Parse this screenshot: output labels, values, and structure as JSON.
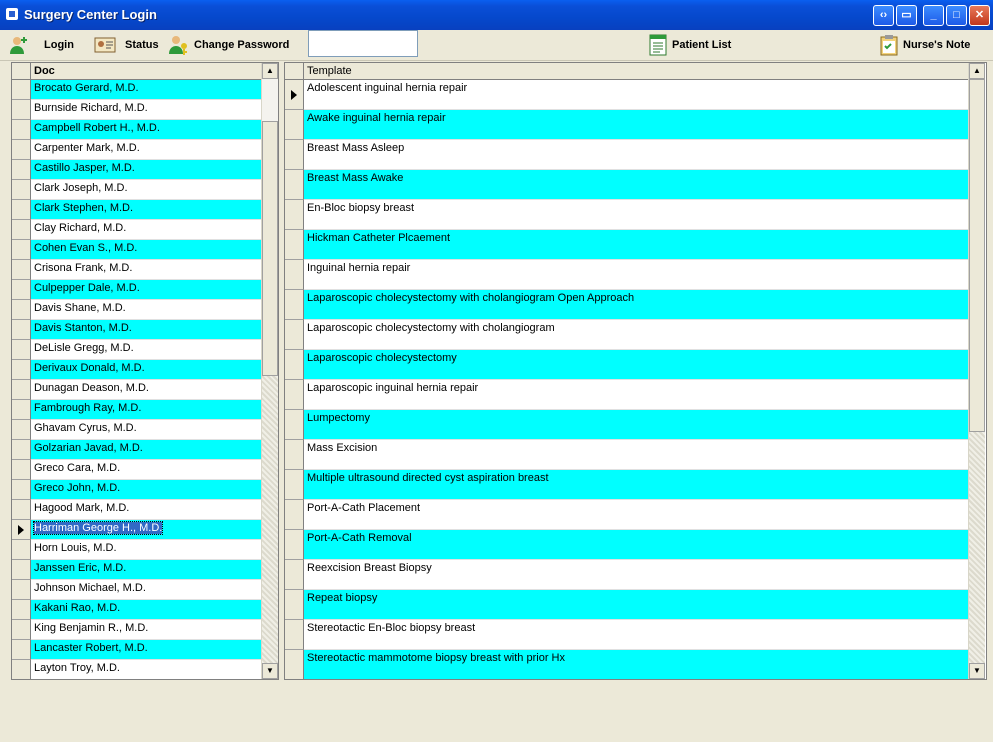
{
  "window": {
    "title": "Surgery Center Login"
  },
  "toolbar": {
    "login_label": "Login",
    "status_label": "Status",
    "change_password_label": "Change Password",
    "input_value": "",
    "patient_list_label": "Patient List",
    "nurses_note_label": "Nurse's Note"
  },
  "doctors": {
    "header": "Doc",
    "selected_index": 22,
    "rows": [
      "Brocato Gerard, M.D.",
      "Burnside Richard, M.D.",
      "Campbell Robert H., M.D.",
      "Carpenter Mark, M.D.",
      "Castillo Jasper, M.D.",
      "Clark Joseph, M.D.",
      "Clark Stephen, M.D.",
      "Clay Richard, M.D.",
      "Cohen Evan S., M.D.",
      "Crisona Frank, M.D.",
      "Culpepper Dale, M.D.",
      "Davis Shane, M.D.",
      "Davis Stanton, M.D.",
      "DeLisle Gregg, M.D.",
      "Derivaux Donald, M.D.",
      "Dunagan Deason, M.D.",
      "Fambrough Ray, M.D.",
      "Ghavam Cyrus, M.D.",
      "Golzarian Javad, M.D.",
      "Greco Cara, M.D.",
      "Greco John, M.D.",
      "Hagood Mark, M.D.",
      "Harriman George H., M.D.",
      "Horn Louis, M.D.",
      "Janssen Eric, M.D.",
      "Johnson Michael, M.D.",
      "Kakani Rao, M.D.",
      "King Benjamin R., M.D.",
      "Lancaster Robert, M.D.",
      "Layton Troy, M.D."
    ]
  },
  "templates": {
    "header": "Template",
    "current_index": 0,
    "rows": [
      "Adolescent inguinal hernia repair",
      "Awake inguinal hernia repair",
      "Breast Mass Asleep",
      "Breast Mass Awake",
      "En-Bloc biopsy breast",
      "Hickman Catheter Plcaement",
      "Inguinal hernia repair",
      "Laparoscopic cholecystectomy with cholangiogram Open Approach",
      "Laparoscopic cholecystectomy with cholangiogram",
      "Laparoscopic cholecystectomy",
      "Laparoscopic inguinal hernia repair",
      "Lumpectomy",
      "Mass Excision",
      "Multiple ultrasound directed cyst aspiration breast",
      "Port-A-Cath Placement",
      "Port-A-Cath Removal",
      "Reexcision Breast Biopsy",
      "Repeat biopsy",
      "Stereotactic En-Bloc biopsy breast",
      "Stereotactic mammotome biopsy breast with prior Hx"
    ]
  },
  "colors": {
    "row_highlight": "#00ffff",
    "selection": "#316ac5"
  }
}
